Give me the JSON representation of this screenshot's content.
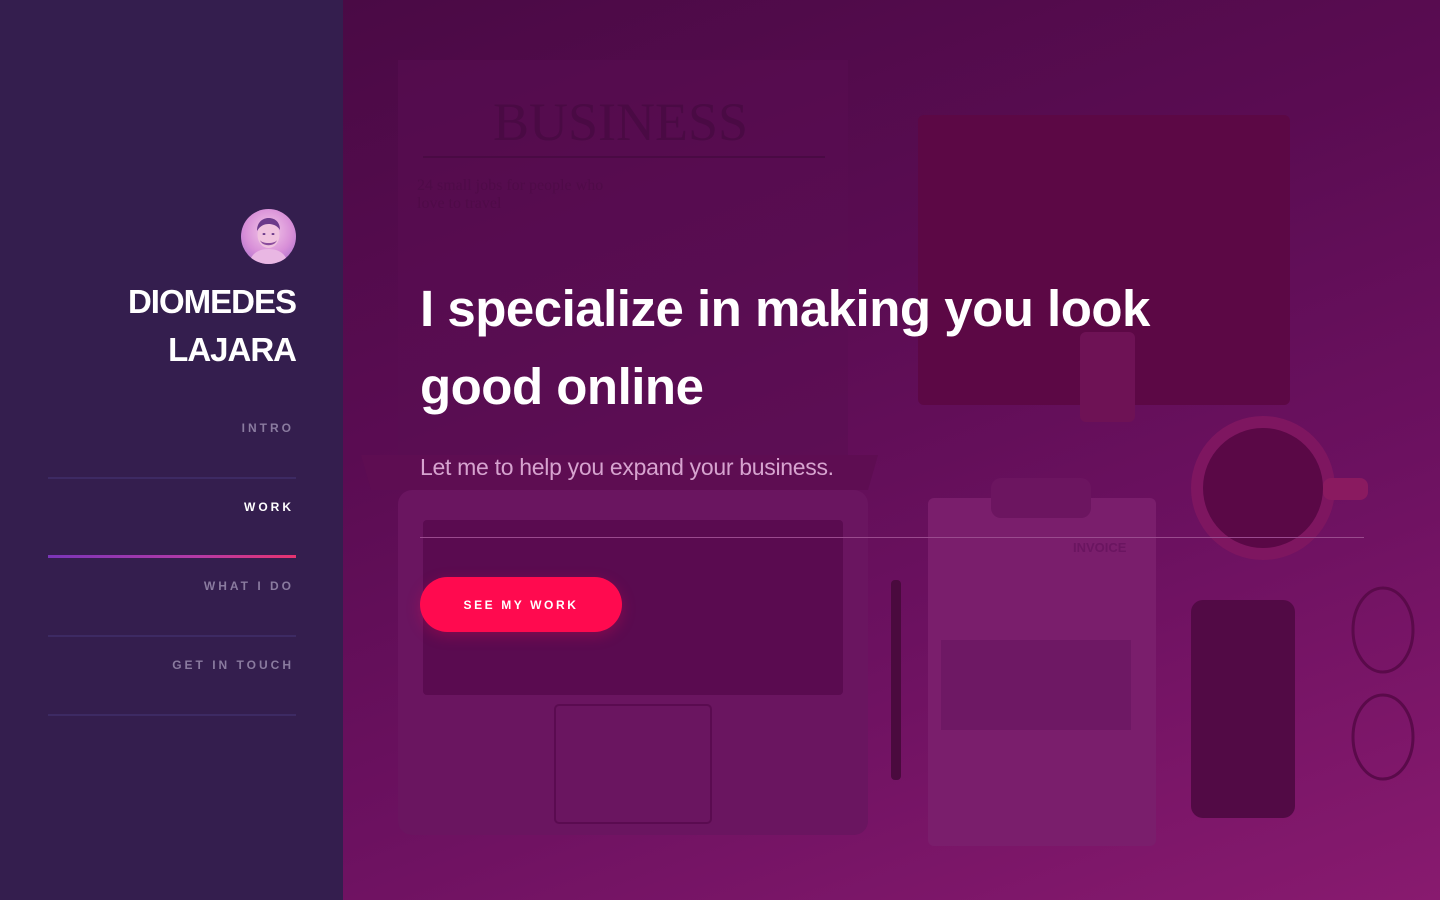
{
  "profile": {
    "first_name": "DIOMEDES",
    "last_name": "LAJARA",
    "avatar_icon": "user-avatar"
  },
  "nav": {
    "items": [
      {
        "label": "INTRO",
        "active": false
      },
      {
        "label": "WORK",
        "active": true
      },
      {
        "label": "WHAT I DO",
        "active": false
      },
      {
        "label": "GET IN TOUCH",
        "active": false
      }
    ]
  },
  "hero": {
    "headline": "I specialize in making you look good online",
    "subline": "Let me to help you expand your business.",
    "cta_label": "SEE MY WORK",
    "background_image": {
      "newspaper_masthead": "BUSINESS",
      "newspaper_teaser_line1": "24 small jobs for people who",
      "newspaper_teaser_line2": "love to travel",
      "invoice_heading": "INVOICE"
    }
  },
  "colors": {
    "sidebar_bg": "#341e4e",
    "hero_overlay": "#5a0c52",
    "cta": "#ff0a4f",
    "nav_inactive": "#8a7b9f",
    "nav_active": "#ffffff",
    "subline": "#d6a3cf"
  }
}
